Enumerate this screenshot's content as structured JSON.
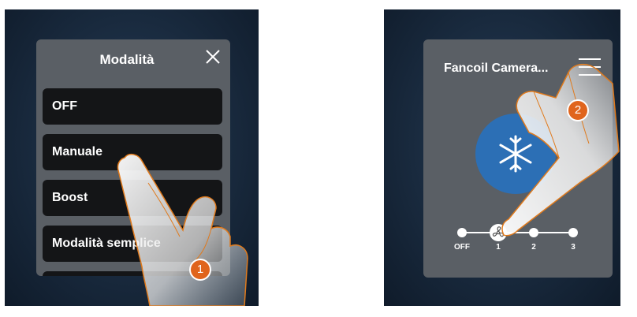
{
  "left_panel": {
    "title": "Modalità",
    "items": [
      {
        "label": "OFF"
      },
      {
        "label": "Manuale"
      },
      {
        "label": "Boost"
      },
      {
        "label": "Modalità semplice"
      }
    ],
    "step_badge": "1"
  },
  "right_panel": {
    "title": "Fancoil Camera...",
    "speed_labels": [
      "OFF",
      "1",
      "2",
      "3"
    ],
    "selected_speed": "1",
    "step_badge": "2"
  },
  "colors": {
    "badge": "#e0641c",
    "mode_circle": "#2c6fb5",
    "hand_outline": "#e07a1c"
  },
  "icons": {
    "close": "close-icon",
    "menu": "hamburger-menu-icon",
    "mode": "snowflake-icon",
    "fan": "fan-icon"
  }
}
